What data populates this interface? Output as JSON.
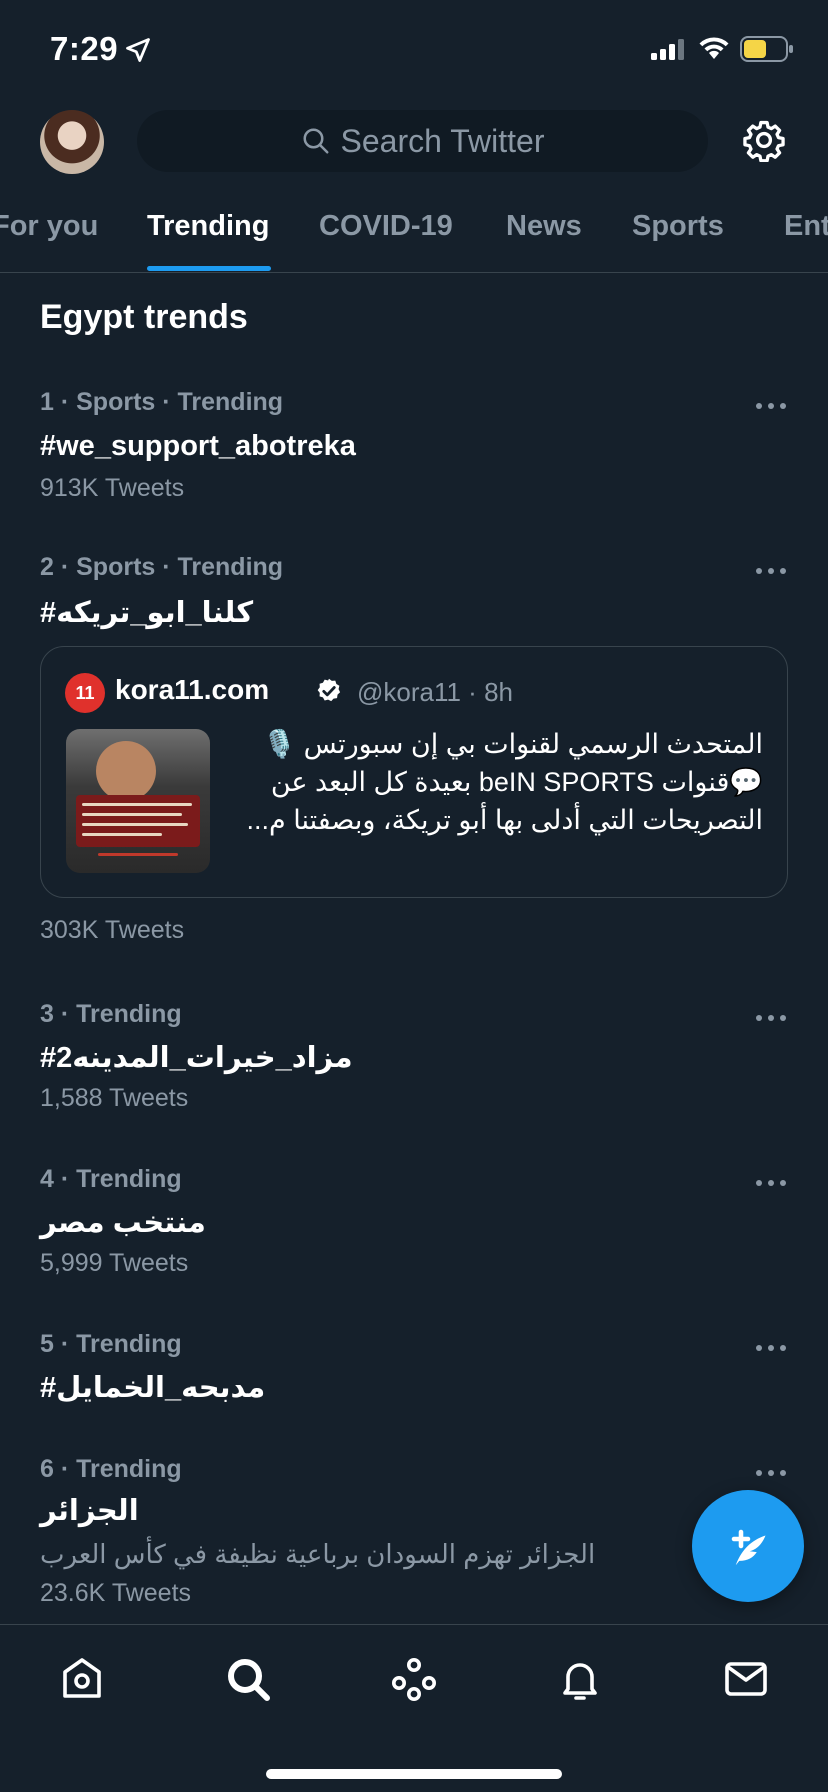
{
  "status_bar": {
    "time": "7:29"
  },
  "header": {
    "search_placeholder": "Search Twitter"
  },
  "tabs": [
    {
      "label": "For you"
    },
    {
      "label": "Trending"
    },
    {
      "label": "COVID-19"
    },
    {
      "label": "News"
    },
    {
      "label": "Sports"
    },
    {
      "label": "Ent"
    }
  ],
  "section_title": "Egypt trends",
  "trends": [
    {
      "meta": "1 · Sports · Trending",
      "name": "#we_support_abotreka",
      "count": "913K Tweets"
    },
    {
      "meta": "2 · Sports · Trending",
      "name": "#كلنا_ابو_تريكه",
      "count": "303K Tweets",
      "card": {
        "author": "kora11.com",
        "handle": "@kora11 · 8h",
        "text_lines": [
          "المتحدث الرسمي لقنوات بي إن سبورتس 🎙️",
          "💬قنوات beIN SPORTS بعيدة كل البعد عن",
          "التصريحات التي أدلى بها أبو تريكة، وبصفتنا م..."
        ]
      }
    },
    {
      "meta": "3 · Trending",
      "name": "#مزاد_خيرات_المدينه2",
      "count": "1,588 Tweets"
    },
    {
      "meta": "4 · Trending",
      "name": "منتخب مصر",
      "count": "5,999 Tweets"
    },
    {
      "meta": "5 · Trending",
      "name": "#مدبحه_الخمايل",
      "count": ""
    },
    {
      "meta": "6 · Trending",
      "name": "الجزائر",
      "description": "الجزائر تهزم السودان برباعية نظيفة في كأس العرب",
      "count": "23.6K Tweets"
    }
  ],
  "colors": {
    "background": "#15202b",
    "accent": "#1d9bf0",
    "muted": "#8b98a5",
    "divider": "#38444d"
  },
  "bottom_nav": [
    "home-icon",
    "search-icon",
    "spaces-icon",
    "notifications-icon",
    "messages-icon"
  ]
}
